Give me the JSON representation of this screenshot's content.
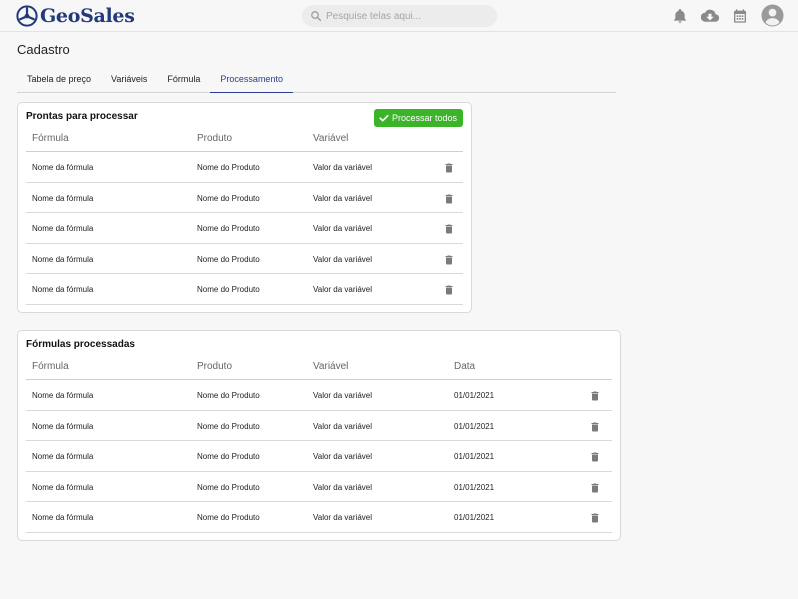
{
  "app": {
    "logo_text": "GeoSales"
  },
  "search": {
    "placeholder": "Pesquise telas aqui..."
  },
  "header_icons": [
    "bell-icon",
    "cloud-download-icon",
    "calendar-icon",
    "account-icon"
  ],
  "page": {
    "title": "Cadastro"
  },
  "tabs": [
    {
      "label": "Tabela de preço",
      "active": false
    },
    {
      "label": "Variáveis",
      "active": false
    },
    {
      "label": "Fórmula",
      "active": false
    },
    {
      "label": "Processamento",
      "active": true
    }
  ],
  "ready": {
    "title": "Prontas para processar",
    "button_label": "Processar todos",
    "columns": [
      "Fórmula",
      "Produto",
      "Variável"
    ],
    "rows": [
      {
        "formula": "Nome da fórmula",
        "produto": "Nome do Produto",
        "variavel": "Valor da variável"
      },
      {
        "formula": "Nome da fórmula",
        "produto": "Nome do Produto",
        "variavel": "Valor da variável"
      },
      {
        "formula": "Nome da fórmula",
        "produto": "Nome do Produto",
        "variavel": "Valor da variável"
      },
      {
        "formula": "Nome da fórmula",
        "produto": "Nome do Produto",
        "variavel": "Valor da variável"
      },
      {
        "formula": "Nome da fórmula",
        "produto": "Nome do Produto",
        "variavel": "Valor da variável"
      }
    ]
  },
  "processed": {
    "title": "Fórmulas processadas",
    "columns": [
      "Fórmula",
      "Produto",
      "Variável",
      "Data"
    ],
    "rows": [
      {
        "formula": "Nome da fórmula",
        "produto": "Nome do Produto",
        "variavel": "Valor da variável",
        "data": "01/01/2021"
      },
      {
        "formula": "Nome da fórmula",
        "produto": "Nome do Produto",
        "variavel": "Valor da variável",
        "data": "01/01/2021"
      },
      {
        "formula": "Nome da fórmula",
        "produto": "Nome do Produto",
        "variavel": "Valor da variável",
        "data": "01/01/2021"
      },
      {
        "formula": "Nome da fórmula",
        "produto": "Nome do Produto",
        "variavel": "Valor da variável",
        "data": "01/01/2021"
      },
      {
        "formula": "Nome da fórmula",
        "produto": "Nome do Produto",
        "variavel": "Valor da variável",
        "data": "01/01/2021"
      }
    ]
  },
  "colors": {
    "brand": "#233a7a",
    "accent": "#2a3d8f",
    "success": "#3bb42a",
    "icon_gray": "#8a8a8a"
  }
}
